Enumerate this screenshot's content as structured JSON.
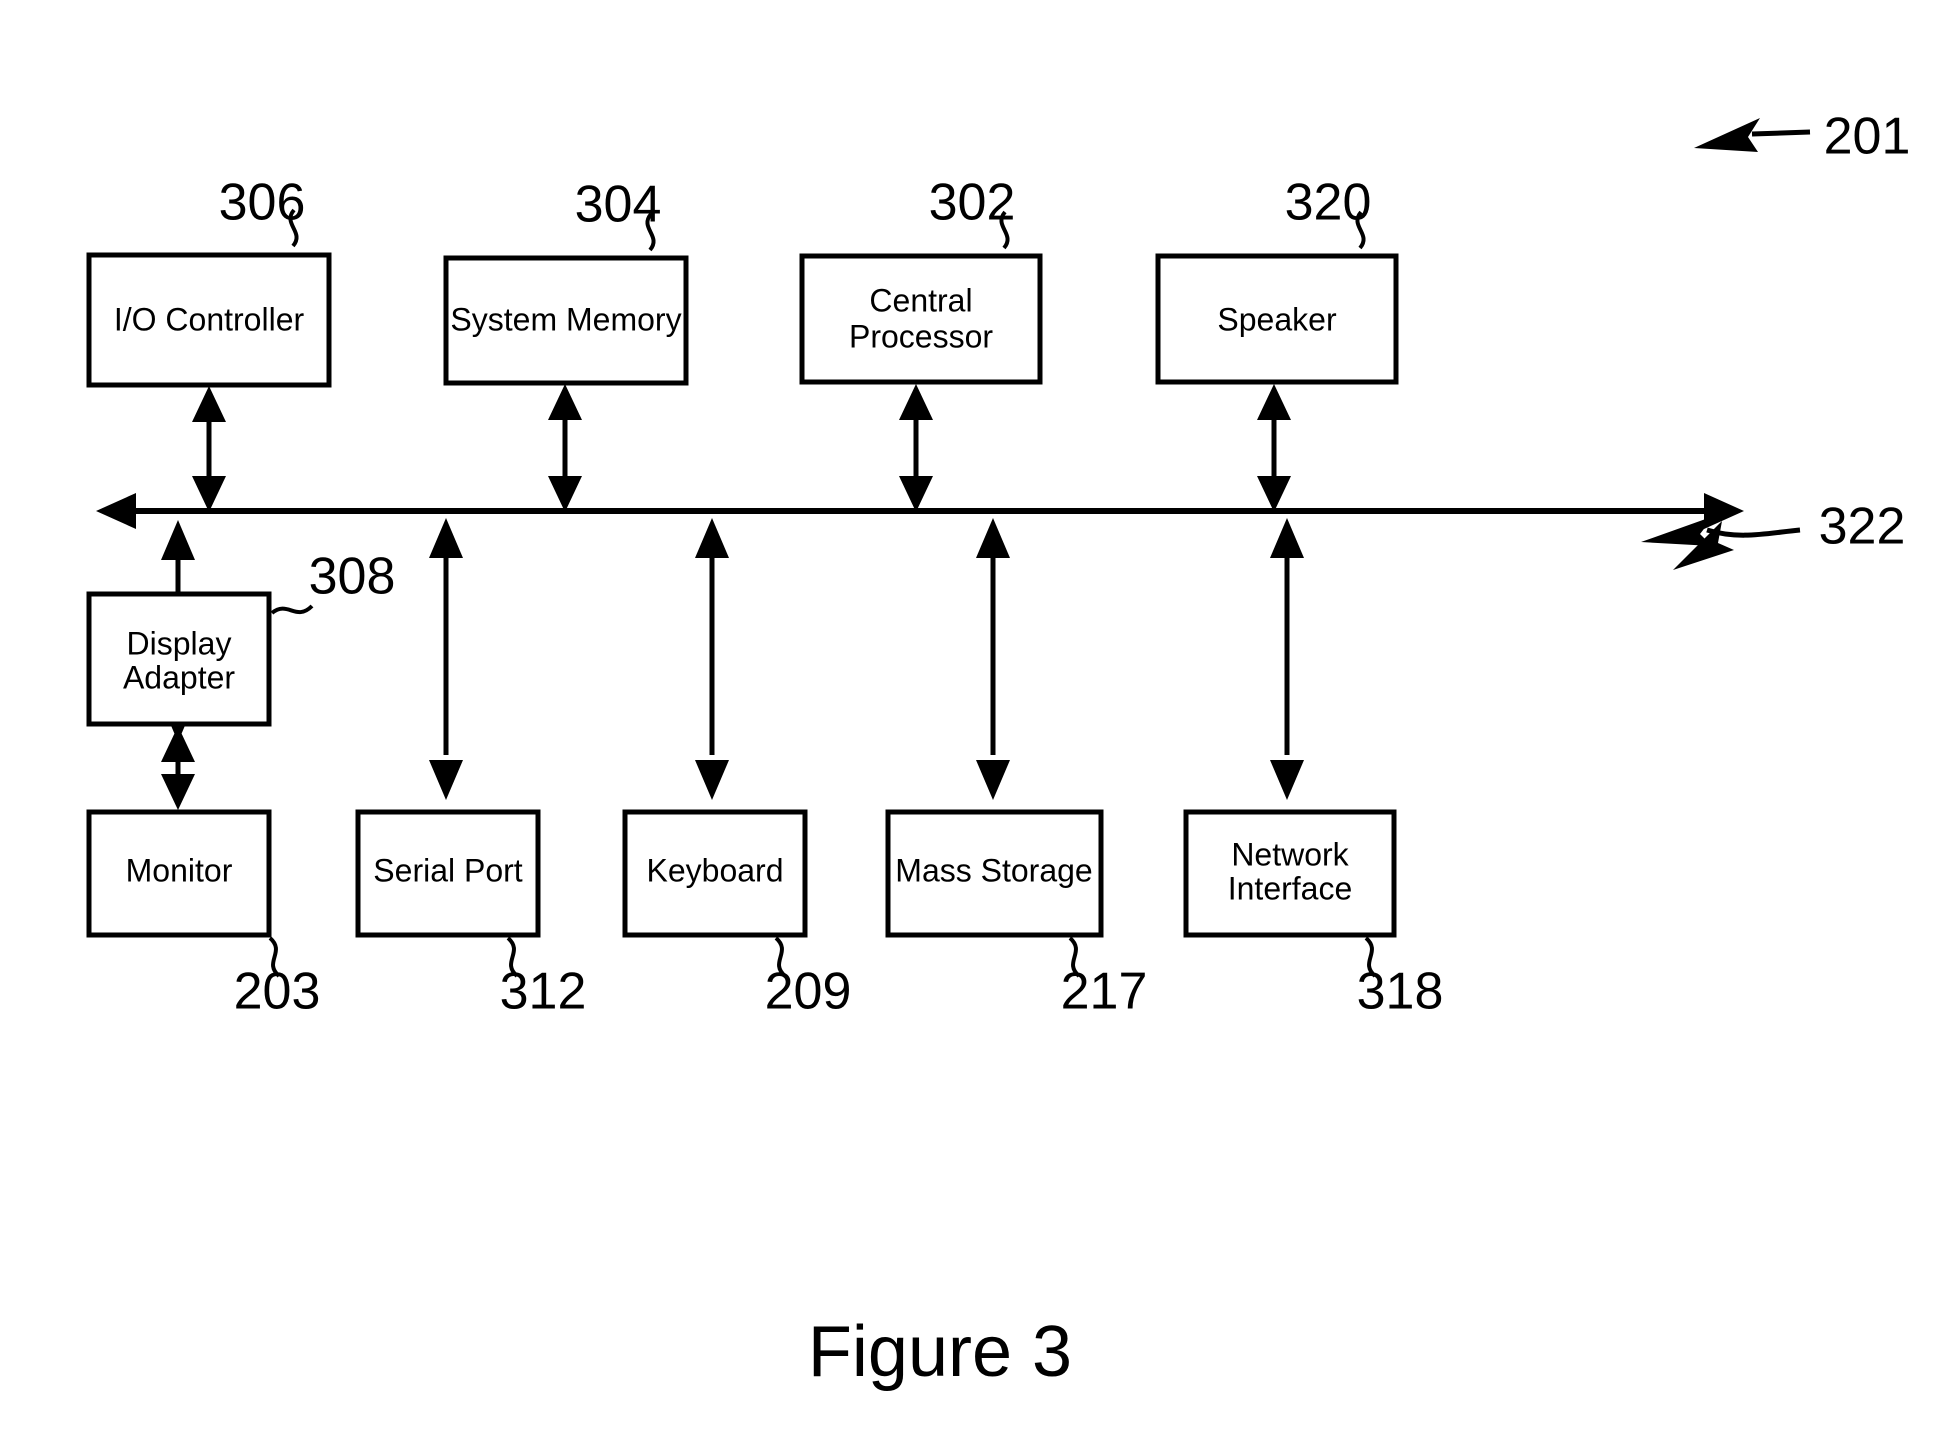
{
  "figure": {
    "caption": "Figure 3",
    "overall_ref": "201",
    "bus_ref": "322"
  },
  "top_row": [
    {
      "label": "I/O Controller",
      "ref": "306",
      "lines": [
        "I/O Controller"
      ]
    },
    {
      "label": "System Memory",
      "ref": "304",
      "lines": [
        "System Memory"
      ]
    },
    {
      "label": "Central Processor",
      "ref": "302",
      "lines": [
        "Central",
        "Processor"
      ]
    },
    {
      "label": "Speaker",
      "ref": "320",
      "lines": [
        "Speaker"
      ]
    }
  ],
  "middle_row": [
    {
      "label": "Display Adapter",
      "ref": "308",
      "lines": [
        "Display",
        "Adapter"
      ]
    }
  ],
  "bottom_row": [
    {
      "label": "Monitor",
      "ref": "203",
      "lines": [
        "Monitor"
      ]
    },
    {
      "label": "Serial Port",
      "ref": "312",
      "lines": [
        "Serial Port"
      ]
    },
    {
      "label": "Keyboard",
      "ref": "209",
      "lines": [
        "Keyboard"
      ]
    },
    {
      "label": "Mass Storage",
      "ref": "217",
      "lines": [
        "Mass Storage"
      ]
    },
    {
      "label": "Network Interface",
      "ref": "318",
      "lines": [
        "Network",
        "Interface"
      ]
    }
  ],
  "colors": {
    "stroke": "#000000",
    "background": "#ffffff"
  }
}
